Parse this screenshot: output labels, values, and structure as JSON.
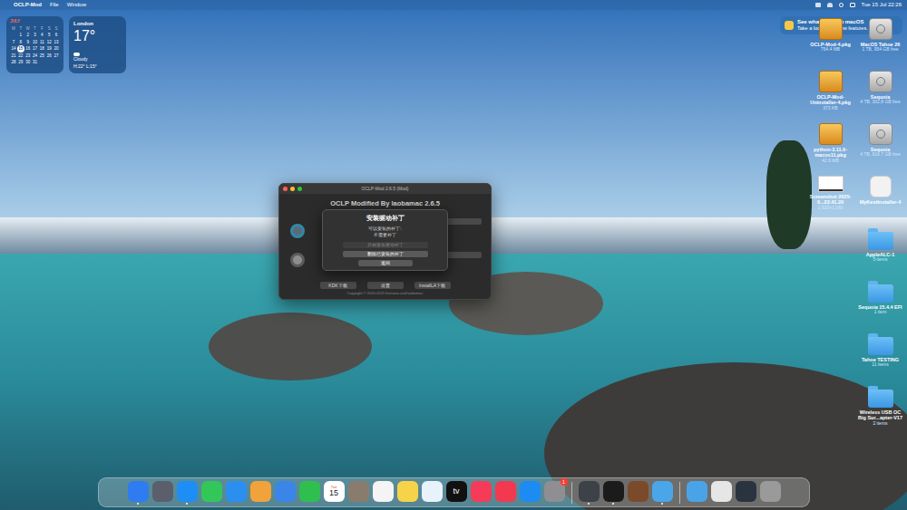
{
  "menu_bar": {
    "apple": "",
    "app": "OCLP-Mod",
    "menus": [
      "File",
      "Window"
    ],
    "clock": "Tue 15 Jul 22:26"
  },
  "notification": {
    "title": "See what's new in macOS",
    "body": "Take a look at the new features."
  },
  "calendar_widget": {
    "month": "JULY",
    "weekdays": [
      "M",
      "T",
      "W",
      "T",
      "F",
      "S",
      "S"
    ],
    "weeks": [
      [
        "",
        "1",
        "2",
        "3",
        "4",
        "5",
        "6"
      ],
      [
        "7",
        "8",
        "9",
        "10",
        "11",
        "12",
        "13"
      ],
      [
        "14",
        "15",
        "16",
        "17",
        "18",
        "19",
        "20"
      ],
      [
        "21",
        "22",
        "23",
        "24",
        "25",
        "26",
        "27"
      ],
      [
        "28",
        "29",
        "30",
        "31",
        "",
        "",
        ""
      ]
    ],
    "today": "15"
  },
  "weather_widget": {
    "city": "London",
    "temperature": "17°",
    "condition": "Cloudy",
    "range": "H:22° L:15°"
  },
  "desktop_icons": [
    {
      "name": "OCLP-Mod-4.pkg",
      "info": "754.4 MB",
      "kind": "pkg"
    },
    {
      "name": "MacOS Tahoe 26",
      "info": "1 TB, 954 GB free",
      "kind": "disk"
    },
    {
      "name": "OCLP-Mod-Uninstaller-4.pkg",
      "info": "373 KB",
      "kind": "pkg"
    },
    {
      "name": "Sequoia",
      "info": "4 TB, 302.8 GB free",
      "kind": "disk"
    },
    {
      "name": "python-3.11.0-macos11.pkg",
      "info": "42.6 MB",
      "kind": "pkg"
    },
    {
      "name": "Sequoia",
      "info": "4 TB, 816.7 GB free",
      "kind": "disk"
    },
    {
      "name": "Screenshot 2025-0...22.41.20",
      "info": "1,920×1,080",
      "kind": "image"
    },
    {
      "name": "MyKextInstaller-4",
      "info": "",
      "kind": "app"
    },
    {
      "name": "AppleALC-1",
      "info": "5 items",
      "kind": "folder"
    },
    {
      "name": "Sequoia 15.4.4 EFI",
      "info": "1 item",
      "kind": "folder"
    },
    {
      "name": "Tahoe TESTING",
      "info": "11 items",
      "kind": "folder"
    },
    {
      "name": "Wireless USB OC Big Sur...apter-V17",
      "info": "2 items",
      "kind": "folder"
    }
  ],
  "window": {
    "title": "OCLP-Mod 2.6.5 (Mod)",
    "header": "OCLP Modified By laobamac 2.6.5",
    "footer_buttons": [
      "KDK下载",
      "设置",
      "InstallLA下载"
    ],
    "copyright": "Copyright © 2020-2025 Dortania and laobamac",
    "dialog": {
      "title": "安装驱动补丁",
      "lines": [
        "可以安装的补丁:",
        "不需要补丁"
      ],
      "buttons": [
        {
          "label": "开始安装驱动补丁",
          "disabled": true
        },
        {
          "label": "删除已安装的补丁",
          "disabled": false
        },
        {
          "label": "返回",
          "disabled": false
        }
      ]
    }
  },
  "dock": [
    {
      "kind": "app",
      "color": "#2f7cf0",
      "label": "",
      "sublabel": "",
      "badge": "",
      "running": true
    },
    {
      "kind": "app",
      "color": "#5b5f6b",
      "label": "",
      "sublabel": "",
      "badge": "",
      "running": false
    },
    {
      "kind": "app",
      "color": "#1d8ef5",
      "label": "",
      "sublabel": "",
      "badge": "",
      "running": true
    },
    {
      "kind": "app",
      "color": "#33c759",
      "label": "",
      "sublabel": "",
      "badge": "",
      "running": false
    },
    {
      "kind": "app",
      "color": "#2b8ff0",
      "label": "",
      "sublabel": "",
      "badge": "",
      "running": false
    },
    {
      "kind": "app",
      "color": "#f2a23a",
      "label": "",
      "sublabel": "",
      "badge": "",
      "running": false
    },
    {
      "kind": "app",
      "color": "#3a86e8",
      "label": "",
      "sublabel": "",
      "badge": "",
      "running": false
    },
    {
      "kind": "app",
      "color": "#2fbf4f",
      "label": "",
      "sublabel": "",
      "badge": "",
      "running": false
    },
    {
      "kind": "app",
      "color": "#ffffff",
      "label": "15",
      "sublabel": "Tue",
      "badge": "",
      "running": false
    },
    {
      "kind": "app",
      "color": "#8a7c6c",
      "label": "",
      "sublabel": "",
      "badge": "",
      "running": false
    },
    {
      "kind": "app",
      "color": "#f4f4f4",
      "label": "",
      "sublabel": "",
      "badge": "",
      "running": false
    },
    {
      "kind": "app",
      "color": "#f7d34a",
      "label": "",
      "sublabel": "",
      "badge": "",
      "running": false
    },
    {
      "kind": "app",
      "color": "#e8f2fb",
      "label": "",
      "sublabel": "",
      "badge": "",
      "running": false
    },
    {
      "kind": "app",
      "color": "#111111",
      "label": "tv",
      "sublabel": "",
      "badge": "",
      "running": false
    },
    {
      "kind": "app",
      "color": "#f53b57",
      "label": "",
      "sublabel": "",
      "badge": "",
      "running": false
    },
    {
      "kind": "app",
      "color": "#f2394f",
      "label": "",
      "sublabel": "",
      "badge": "",
      "running": false
    },
    {
      "kind": "app",
      "color": "#1c8cf3",
      "label": "",
      "sublabel": "",
      "badge": "",
      "running": false
    },
    {
      "kind": "app",
      "color": "#8e8e93",
      "label": "",
      "sublabel": "",
      "badge": "1",
      "running": false
    },
    {
      "kind": "separator",
      "color": "#ffffff",
      "label": "",
      "sublabel": "",
      "badge": "",
      "running": false
    },
    {
      "kind": "app",
      "color": "#3d4148",
      "label": "",
      "sublabel": "",
      "badge": "",
      "running": true
    },
    {
      "kind": "app",
      "color": "#1b1b1b",
      "label": "",
      "sublabel": "",
      "badge": "",
      "running": true
    },
    {
      "kind": "app",
      "color": "#7a4a2a",
      "label": "",
      "sublabel": "",
      "badge": "",
      "running": false
    },
    {
      "kind": "app",
      "color": "#4aa6e8",
      "label": "",
      "sublabel": "",
      "badge": "",
      "running": true
    },
    {
      "kind": "separator",
      "color": "#ffffff",
      "label": "",
      "sublabel": "",
      "badge": "",
      "running": false
    },
    {
      "kind": "app",
      "color": "#4aa3e6",
      "label": "",
      "sublabel": "",
      "badge": "",
      "running": false
    },
    {
      "kind": "app",
      "color": "#e6e6e6",
      "label": "",
      "sublabel": "",
      "badge": "",
      "running": false
    },
    {
      "kind": "app",
      "color": "#2a3340",
      "label": "",
      "sublabel": "",
      "badge": "",
      "running": false
    },
    {
      "kind": "app",
      "color": "#9a9a9a",
      "label": "",
      "sublabel": "",
      "badge": "",
      "running": false
    }
  ]
}
